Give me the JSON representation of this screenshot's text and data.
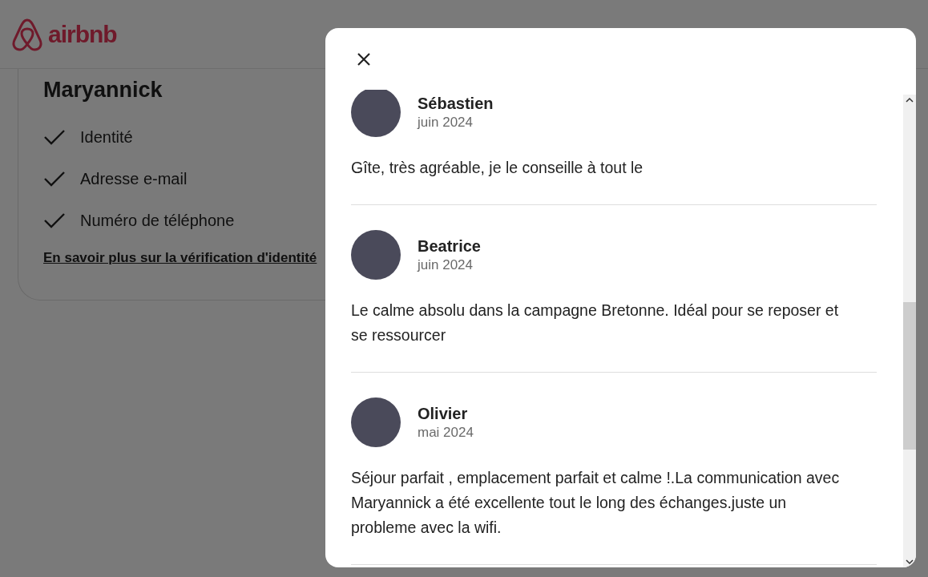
{
  "header": {
    "logo_text": "airbnb"
  },
  "host_card": {
    "name": "Maryannick",
    "verifications": [
      {
        "label": "Identité",
        "checked": true
      },
      {
        "label": "Adresse e-mail",
        "checked": true
      },
      {
        "label": "Numéro de téléphone",
        "checked": true
      }
    ],
    "link": "En savoir plus sur la vérification d'identité"
  },
  "modal": {
    "reviews": [
      {
        "name": "Sébastien",
        "date": "juin 2024",
        "text": "Gîte, très agréable, je le conseille à tout le"
      },
      {
        "name": "Beatrice",
        "date": "juin 2024",
        "text": "Le calme absolu dans la campagne Bretonne. Idéal pour se reposer et se ressourcer"
      },
      {
        "name": "Olivier",
        "date": "mai 2024",
        "text": "Séjour parfait , emplacement parfait et calme !.La communication avec Maryannick a été excellente tout le long des échanges.juste un probleme avec la wifi."
      }
    ]
  }
}
